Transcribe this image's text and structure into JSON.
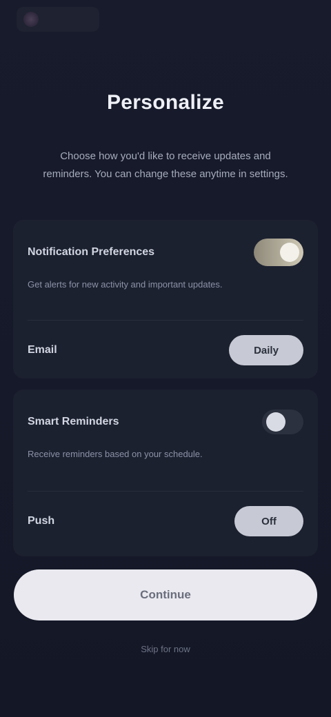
{
  "header": {
    "brand": "",
    "title": "Personalize",
    "subtitle": "Choose how you'd like to receive updates and reminders. You can change these anytime in settings."
  },
  "card_one": {
    "toggle_label": "Notification Preferences",
    "toggle_on": true,
    "description": "Get alerts for new activity and important updates.",
    "select_label": "Email",
    "select_value": "Daily"
  },
  "card_two": {
    "toggle_label": "Smart Reminders",
    "toggle_on": false,
    "description": "Receive reminders based on your schedule.",
    "select_label": "Push",
    "select_value": "Off"
  },
  "actions": {
    "primary_label": "Continue",
    "footer_link": "Skip for now"
  }
}
